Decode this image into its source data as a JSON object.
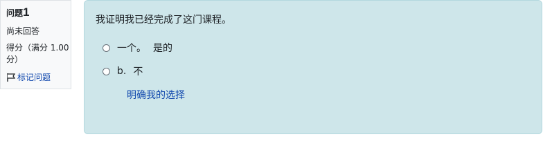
{
  "info": {
    "question_label": "问题",
    "question_number": "1",
    "state": "尚未回答",
    "grade": "得分（满分 1.00分）",
    "flag_label": "标记问题",
    "flag_icon": "flag-icon"
  },
  "question": {
    "text": "我证明我已经完成了这门课程。",
    "options": [
      {
        "letter": "一个。",
        "label": "是的"
      },
      {
        "letter": "b.",
        "label": "不"
      }
    ],
    "clear_label": "明确我的选择"
  },
  "colors": {
    "content_bg": "#cee6ea",
    "link": "#0f47ad",
    "info_bg": "#f8f9fa"
  }
}
